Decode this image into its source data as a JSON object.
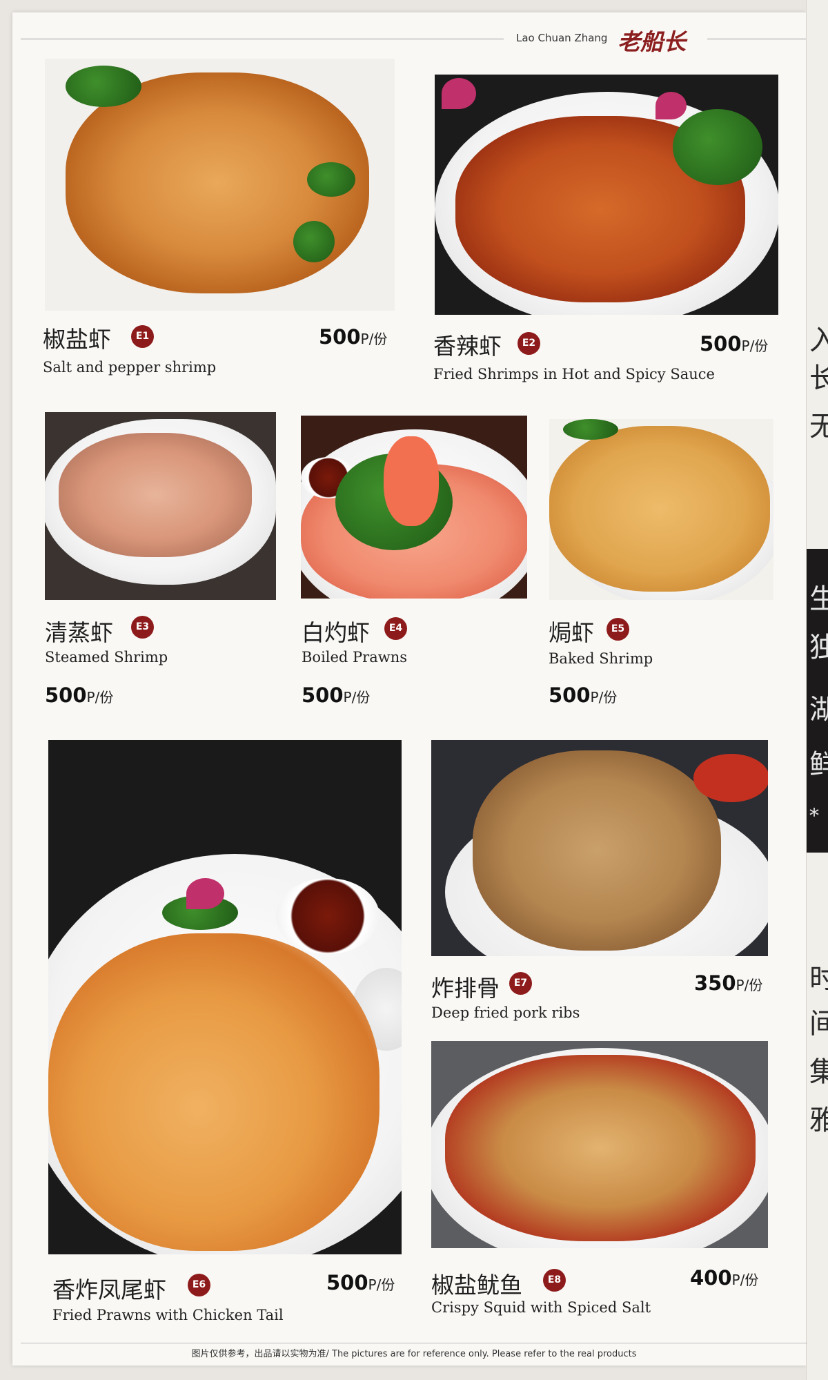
{
  "brand": {
    "en": "Lao Chuan Zhang",
    "cn": "老船长"
  },
  "items": [
    {
      "code": "E1",
      "cn": "椒盐虾",
      "en": "Salt and pepper shrimp",
      "price": "500",
      "unit": "P/份",
      "image": "salt-pepper-shrimp-photo"
    },
    {
      "code": "E2",
      "cn": "香辣虾",
      "en": "Fried Shrimps in Hot and Spicy Sauce",
      "price": "500",
      "unit": "P/份",
      "image": "spicy-shrimp-photo"
    },
    {
      "code": "E3",
      "cn": "清蒸虾",
      "en": "Steamed Shrimp",
      "price": "500",
      "unit": "P/份",
      "image": "steamed-shrimp-photo"
    },
    {
      "code": "E4",
      "cn": "白灼虾",
      "en": "Boiled Prawns",
      "price": "500",
      "unit": "P/份",
      "image": "boiled-prawns-photo"
    },
    {
      "code": "E5",
      "cn": "焗虾",
      "en": "Baked Shrimp",
      "price": "500",
      "unit": "P/份",
      "image": "baked-shrimp-photo"
    },
    {
      "code": "E6",
      "cn": "香炸凤尾虾",
      "en": "Fried Prawns with Chicken Tail",
      "price": "500",
      "unit": "P/份",
      "image": "fried-prawns-photo"
    },
    {
      "code": "E7",
      "cn": "炸排骨",
      "en": "Deep fried pork ribs",
      "price": "350",
      "unit": "P/份",
      "image": "pork-ribs-photo"
    },
    {
      "code": "E8",
      "cn": "椒盐鱿鱼",
      "en": "Crispy Squid with Spiced Salt",
      "price": "400",
      "unit": "P/份",
      "image": "spiced-squid-photo"
    }
  ],
  "footer": "图片仅供参考，出品请以实物为准/ The pictures are for reference only. Please refer to the real products",
  "edge": {
    "chars_top": [
      "入",
      "长",
      "无"
    ],
    "chars_dark": [
      "生",
      "独",
      "湖",
      "鲜",
      "*"
    ],
    "chars_bottom": [
      "时",
      "间",
      "集",
      "雅"
    ]
  },
  "colors": {
    "code_badge": "#8e1b1b",
    "brand_red": "#8b1e1e",
    "paper": "#f9f8f5"
  }
}
